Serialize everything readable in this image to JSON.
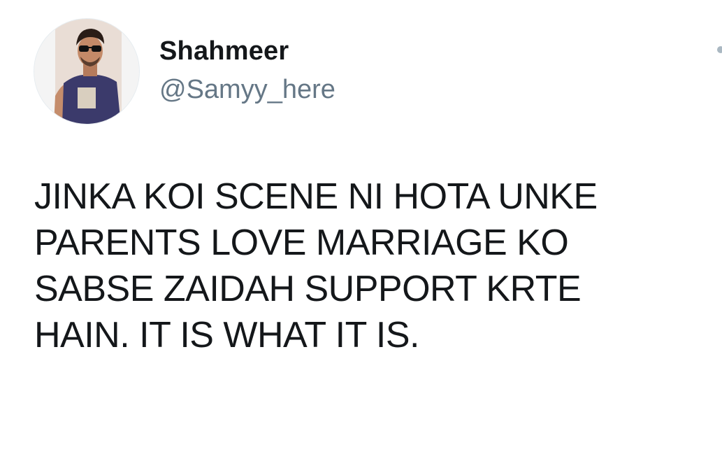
{
  "tweet": {
    "author": {
      "display_name": "Shahmeer",
      "handle": "@Samyy_here",
      "avatar_icon": "profile-photo"
    },
    "text_lines": [
      "JINKA KOI SCENE NI HOTA UNKE",
      "PARENTS LOVE MARRIAGE KO",
      "SABSE ZAIDAH SUPPORT KRTE",
      "HAIN. IT IS WHAT IT IS."
    ],
    "menu_icon": "chevron-down-icon"
  },
  "colors": {
    "name": "#14171a",
    "handle": "#657786",
    "text": "#14171a",
    "background": "#ffffff"
  }
}
